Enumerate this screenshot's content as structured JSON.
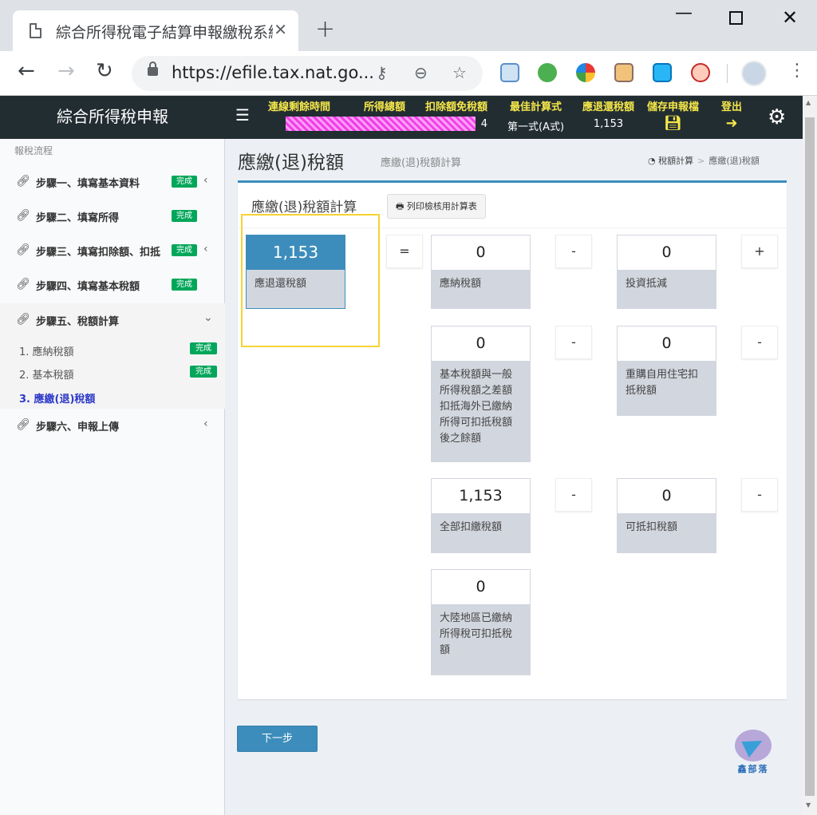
{
  "browser": {
    "tab_title": "綜合所得稅電子結算申報繳稅系統",
    "url": "https://efile.tax.nat.go...",
    "new_tab_symbol": "+",
    "close_symbol": "✕"
  },
  "header": {
    "brand": "綜合所得稅申報",
    "items": [
      {
        "label": "連線剩餘時間",
        "value": ""
      },
      {
        "label": "所得總額",
        "value": ""
      },
      {
        "label": "扣除額免稅額",
        "value": "4"
      },
      {
        "label": "最佳計算式",
        "value": "第一式(A式)"
      },
      {
        "label": "應退還稅額",
        "value": "1,153"
      },
      {
        "label": "儲存申報檔",
        "icon": "save-icon"
      },
      {
        "label": "登出",
        "icon": "logout-icon"
      }
    ]
  },
  "sidebar": {
    "section_title": "報稅流程",
    "steps": [
      {
        "label": "步驟一、填寫基本資料",
        "badge": "完成"
      },
      {
        "label": "步驟二、填寫所得",
        "badge": "完成"
      },
      {
        "label": "步驟三、填寫扣除額、扣抵",
        "badge": "完成"
      },
      {
        "label": "步驟四、填寫基本稅額",
        "badge": "完成"
      },
      {
        "label": "步驟五、稅額計算",
        "badge": ""
      },
      {
        "label": "步驟六、申報上傳",
        "badge": ""
      }
    ],
    "substeps": [
      {
        "label": "1. 應納稅額",
        "badge": "完成"
      },
      {
        "label": "2. 基本稅額",
        "badge": "完成"
      },
      {
        "label": "3. 應繳(退)稅額",
        "badge": ""
      }
    ]
  },
  "content": {
    "title": "應繳(退)稅額",
    "subtitle": "應繳(退)稅額計算",
    "breadcrumb": [
      "稅額計算",
      "應繳(退)稅額"
    ],
    "box_title": "應繳(退)稅額計算",
    "print_button": "列印檢核用計算表",
    "result": {
      "value": "1,153",
      "label": "應退還稅額"
    },
    "equals": "=",
    "cards": [
      {
        "value": "0",
        "label": "應納稅額"
      },
      {
        "value": "0",
        "label": "投資抵減"
      },
      {
        "value": "0",
        "label": "基本稅額與一般所得稅額之差額扣抵海外已繳納所得可扣抵稅額後之餘額"
      },
      {
        "value": "0",
        "label": "重購自用住宅扣抵稅額"
      },
      {
        "value": "1,153",
        "label": "全部扣繳稅額"
      },
      {
        "value": "0",
        "label": "可抵扣稅額"
      },
      {
        "value": "0",
        "label": "大陸地區已繳納所得稅可扣抵稅額"
      }
    ],
    "operators": [
      "-",
      "+",
      "-",
      "-",
      "-",
      "-"
    ],
    "next_button": "下一步",
    "watermark": "鑫部落"
  }
}
